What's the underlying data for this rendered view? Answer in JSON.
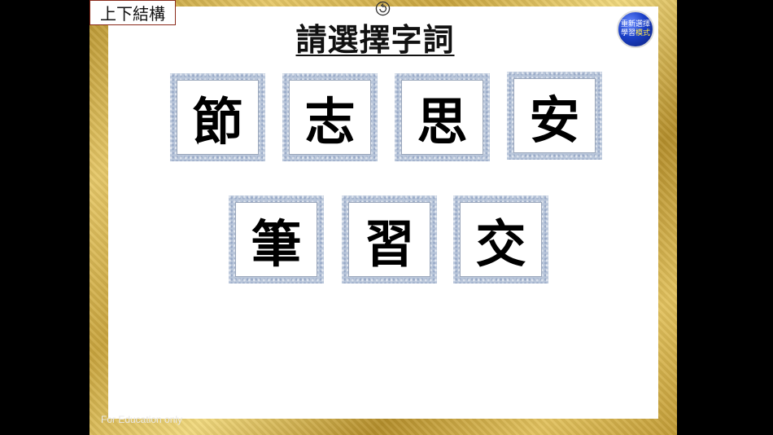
{
  "header": {
    "category_label": "上下結構",
    "title": "請選擇字詞"
  },
  "reset_button": {
    "line1": "重新選擇",
    "line2_a": "學習",
    "line2_b": "模式"
  },
  "cards_row1": [
    "節",
    "志",
    "思",
    "安"
  ],
  "cards_row2": [
    "筆",
    "習",
    "交"
  ],
  "footer": {
    "note": "For Education only"
  },
  "colors": {
    "frame_gold": "#c9a53f",
    "button_blue": "#1a3fc7",
    "card_border": "#b9c6da"
  },
  "icons": {
    "back": "undo-icon"
  }
}
